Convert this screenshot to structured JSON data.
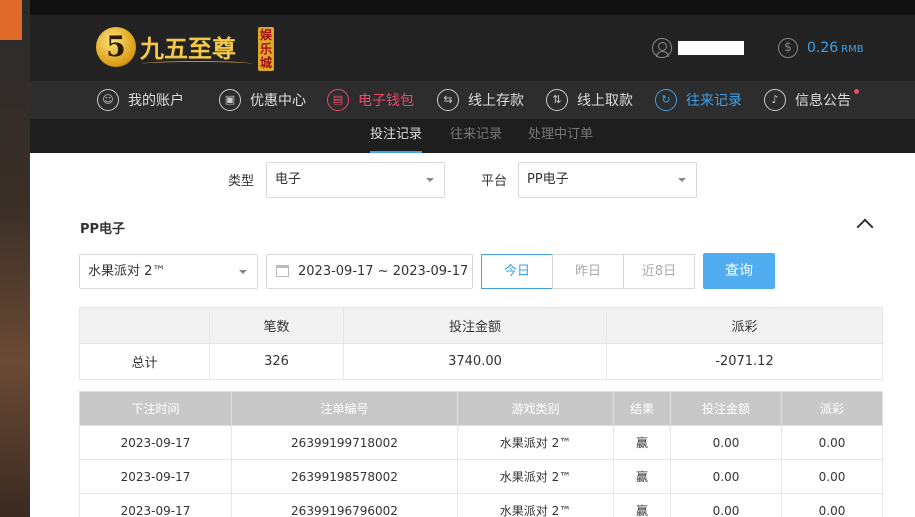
{
  "header": {
    "logo_text": "九五至尊",
    "logo_badge": "5",
    "logo_seal": "娱乐城",
    "balance": "0.26",
    "balance_unit": "RMB",
    "money_icon_glyph": "$"
  },
  "nav": {
    "items": [
      {
        "label": "我的账户",
        "icon": "user-circle-icon",
        "glyph": "☺"
      },
      {
        "label": "优惠中心",
        "icon": "gift-icon",
        "glyph": "▣"
      },
      {
        "label": "电子钱包",
        "icon": "wallet-icon",
        "glyph": "▤"
      },
      {
        "label": "线上存款",
        "icon": "deposit-icon",
        "glyph": "⇆"
      },
      {
        "label": "线上取款",
        "icon": "withdraw-icon",
        "glyph": "⇅"
      },
      {
        "label": "往来记录",
        "icon": "records-icon",
        "glyph": "↻"
      },
      {
        "label": "信息公告",
        "icon": "bell-icon",
        "glyph": "♪"
      }
    ],
    "active_red_color": "#e84a6a",
    "active_blue_color": "#3fa0e8"
  },
  "subnav": {
    "tabs": [
      "投注记录",
      "往来记录",
      "处理中订单"
    ]
  },
  "filters": {
    "type_label": "类型",
    "type_value": "电子",
    "platform_label": "平台",
    "platform_value": "PP电子"
  },
  "section": {
    "title": "PP电子",
    "game_value": "水果派对 2™",
    "date_range": "2023-09-17 ~ 2023-09-17",
    "range_buttons": [
      "今日",
      "昨日",
      "近8日"
    ],
    "query_label": "查询"
  },
  "summary": {
    "headers": [
      "",
      "笔数",
      "投注金额",
      "派彩"
    ],
    "row": [
      "总计",
      "326",
      "3740.00",
      "-2071.12"
    ]
  },
  "records": {
    "headers": [
      "下注时间",
      "注单编号",
      "游戏类别",
      "结果",
      "投注金额",
      "派彩"
    ],
    "rows": [
      [
        "2023-09-17",
        "26399199718002",
        "水果派对 2™",
        "赢",
        "0.00",
        "0.00"
      ],
      [
        "2023-09-17",
        "26399198578002",
        "水果派对 2™",
        "赢",
        "0.00",
        "0.00"
      ],
      [
        "2023-09-17",
        "26399196796002",
        "水果派对 2™",
        "赢",
        "0.00",
        "0.00"
      ]
    ]
  }
}
